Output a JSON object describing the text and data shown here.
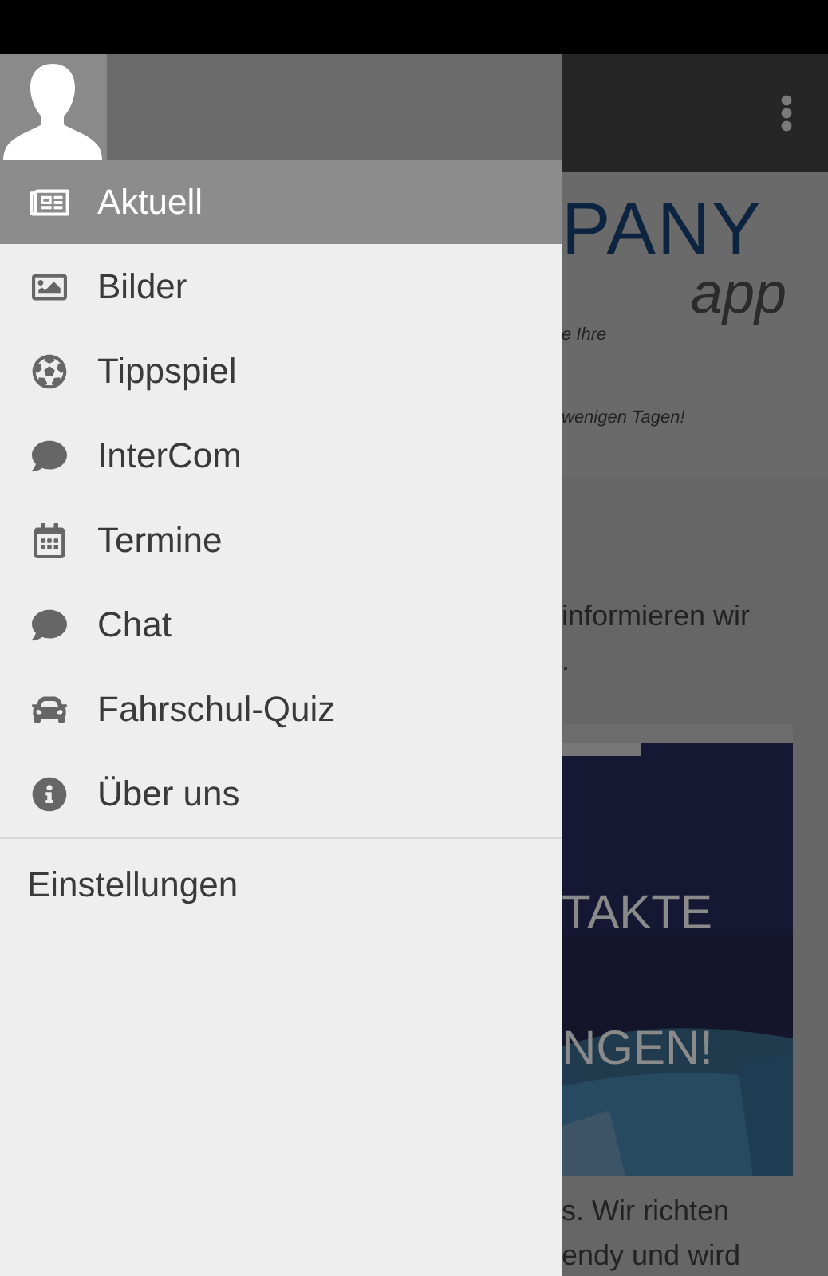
{
  "drawer": {
    "items": [
      {
        "label": "Aktuell",
        "selected": true
      },
      {
        "label": "Bilder",
        "selected": false
      },
      {
        "label": "Tippspiel",
        "selected": false
      },
      {
        "label": "InterCom",
        "selected": false
      },
      {
        "label": "Termine",
        "selected": false
      },
      {
        "label": "Chat",
        "selected": false
      },
      {
        "label": "Fahrschul-Quiz",
        "selected": false
      },
      {
        "label": "Über uns",
        "selected": false
      }
    ],
    "settings": "Einstellungen"
  },
  "content": {
    "logo": "PANY",
    "logo_sub": "app",
    "tagline": [
      "e Ihre",
      "wenigen Tagen!"
    ],
    "intro": [
      "informieren wir",
      "."
    ],
    "banner": [
      "TAKTE",
      "NGEN!"
    ],
    "body": [
      "s. Wir richten",
      "endy und wird"
    ]
  }
}
